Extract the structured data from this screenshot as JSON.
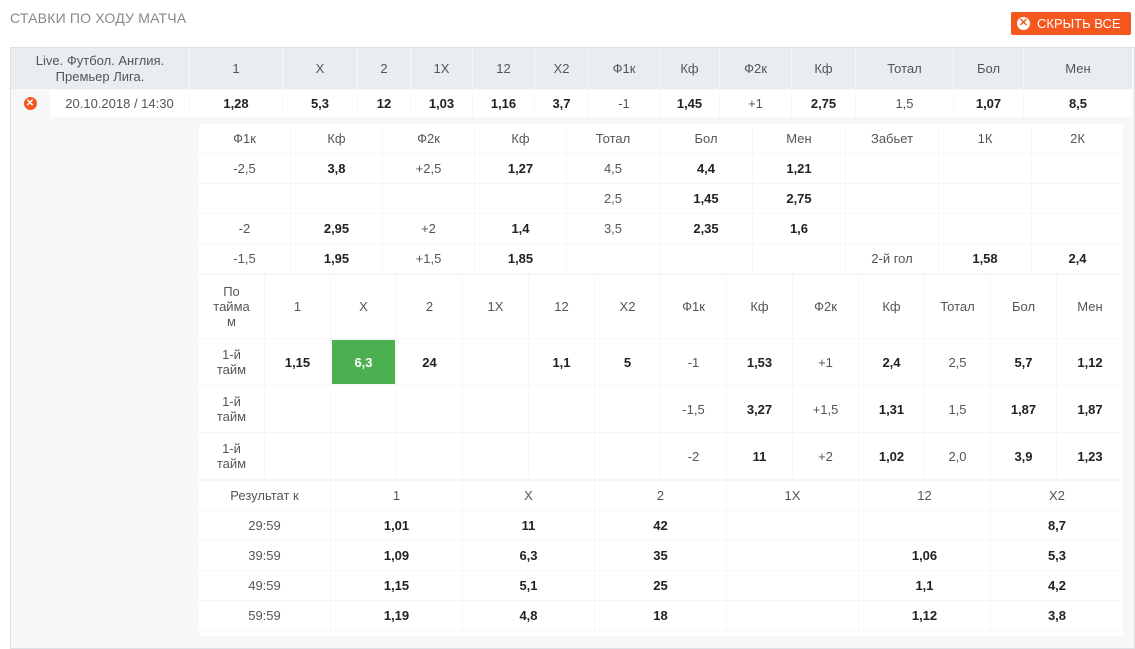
{
  "title": "СТАВКИ ПО ХОДУ МАТЧА",
  "hide_all_label": "СКРЫТЬ ВСЕ",
  "colors": {
    "accent": "#f4581e",
    "highlight": "#4caf50"
  },
  "event": {
    "league_line1": "Live. Футбол. Англия.",
    "league_line2": "Премьер Лига.",
    "datetime": "20.10.2018 / 14:30"
  },
  "main_headers": [
    "1",
    "X",
    "2",
    "1X",
    "12",
    "X2",
    "Ф1к",
    "Кф",
    "Ф2к",
    "Кф",
    "Тотал",
    "Бол",
    "Мен"
  ],
  "main_values": [
    "1,28",
    "5,3",
    "12",
    "1,03",
    "1,16",
    "3,7",
    "-1",
    "1,45",
    "+1",
    "2,75",
    "1,5",
    "1,07",
    "8,5"
  ],
  "corners": {
    "headers": [
      "Ф1к",
      "Кф",
      "Ф2к",
      "Кф",
      "Тотал",
      "Бол",
      "Мен",
      "Забьет",
      "1К",
      "2К"
    ],
    "rows": [
      [
        "-2,5",
        "3,8",
        "+2,5",
        "1,27",
        "4,5",
        "4,4",
        "1,21",
        "",
        "",
        ""
      ],
      [
        "",
        "",
        "",
        "",
        "2,5",
        "1,45",
        "2,75",
        "",
        "",
        ""
      ],
      [
        "-2",
        "2,95",
        "+2",
        "1,4",
        "3,5",
        "2,35",
        "1,6",
        "",
        "",
        ""
      ],
      [
        "-1,5",
        "1,95",
        "+1,5",
        "1,85",
        "",
        "",
        "",
        "2-й гол",
        "1,58",
        "2,4"
      ]
    ]
  },
  "halves": {
    "label_line1": "По",
    "label_line2": "тайма",
    "label_line3": "м",
    "headers": [
      "1",
      "X",
      "2",
      "1X",
      "12",
      "X2",
      "Ф1к",
      "Кф",
      "Ф2к",
      "Кф",
      "Тотал",
      "Бол",
      "Мен"
    ],
    "rows": [
      {
        "l1": "1-й",
        "l2": "тайм",
        "v": [
          "1,15",
          "6,3",
          "24",
          "",
          "1,1",
          "5",
          "-1",
          "1,53",
          "+1",
          "2,4",
          "2,5",
          "5,7",
          "1,12"
        ]
      },
      {
        "l1": "1-й",
        "l2": "тайм",
        "v": [
          "",
          "",
          "",
          "",
          "",
          "",
          "-1,5",
          "3,27",
          "+1,5",
          "1,31",
          "1,5",
          "1,87",
          "1,87"
        ]
      },
      {
        "l1": "1-й",
        "l2": "тайм",
        "v": [
          "",
          "",
          "",
          "",
          "",
          "",
          "-2",
          "11",
          "+2",
          "1,02",
          "2,0",
          "3,9",
          "1,23"
        ]
      }
    ]
  },
  "results": {
    "label": "Результат к",
    "headers": [
      "1",
      "X",
      "2",
      "1X",
      "12",
      "X2"
    ],
    "rows": [
      {
        "t": "29:59",
        "v": [
          "1,01",
          "11",
          "42",
          "",
          "",
          "8,7"
        ]
      },
      {
        "t": "39:59",
        "v": [
          "1,09",
          "6,3",
          "35",
          "",
          "1,06",
          "5,3"
        ]
      },
      {
        "t": "49:59",
        "v": [
          "1,15",
          "5,1",
          "25",
          "",
          "1,1",
          "4,2"
        ]
      },
      {
        "t": "59:59",
        "v": [
          "1,19",
          "4,8",
          "18",
          "",
          "1,12",
          "3,8"
        ]
      }
    ]
  }
}
